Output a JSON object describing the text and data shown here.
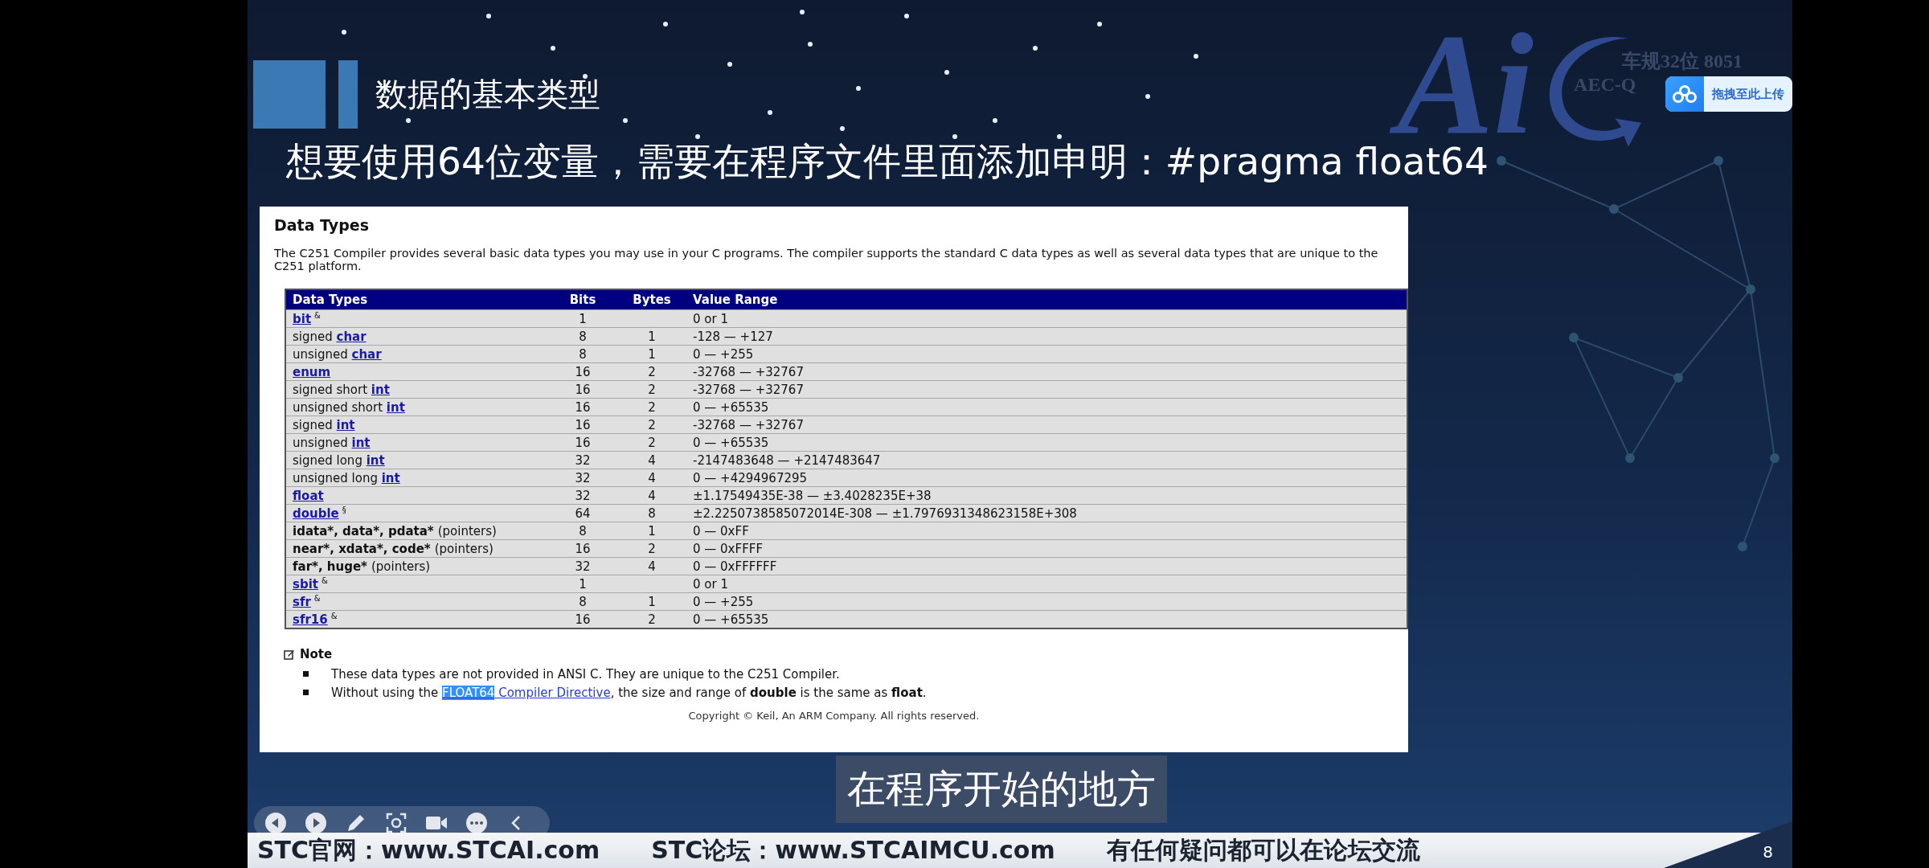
{
  "slide": {
    "title": "数据的基本类型",
    "subheading": "想要使用64位变量，需要在程序文件里面添加申明：#pragma float64",
    "logo": {
      "mark": "Ai",
      "line_1": "车规32位 8051",
      "line_2": "AEC-Q"
    },
    "upload_button": "拖拽至此上传",
    "page_number": "8"
  },
  "document": {
    "title": "Data Types",
    "intro": "The C251 Compiler provides several basic data types you may use in your C programs. The compiler supports the standard C data types as well as several data types that are unique to the C251 platform.",
    "table": {
      "columns": [
        "Data Types",
        "Bits",
        "Bytes",
        "Value Range"
      ],
      "rows": [
        {
          "type": {
            "link": "bit",
            "mark": "&"
          },
          "bits": "1",
          "value_range": "0 or 1"
        },
        {
          "type": {
            "text": "signed ",
            "link": "char"
          },
          "bits": "8",
          "bytes": "1",
          "value_range": "-128 — +127"
        },
        {
          "type": {
            "text": "unsigned ",
            "link": "char"
          },
          "bits": "8",
          "bytes": "1",
          "value_range": "0 — +255"
        },
        {
          "type": {
            "link": "enum"
          },
          "bits": "16",
          "bytes": "2",
          "value_range": "-32768 — +32767"
        },
        {
          "type": {
            "text": "signed short ",
            "link": "int"
          },
          "bits": "16",
          "bytes": "2",
          "value_range": "-32768 — +32767"
        },
        {
          "type": {
            "text": "unsigned short ",
            "link": "int"
          },
          "bits": "16",
          "bytes": "2",
          "value_range": "0 — +65535"
        },
        {
          "type": {
            "text": "signed ",
            "link": "int"
          },
          "bits": "16",
          "bytes": "2",
          "value_range": "-32768 — +32767"
        },
        {
          "type": {
            "text": "unsigned ",
            "link": "int"
          },
          "bits": "16",
          "bytes": "2",
          "value_range": "0 — +65535"
        },
        {
          "type": {
            "text": "signed long ",
            "link": "int"
          },
          "bits": "32",
          "bytes": "4",
          "value_range": "-2147483648 — +2147483647"
        },
        {
          "type": {
            "text": "unsigned long ",
            "link": "int"
          },
          "bits": "32",
          "bytes": "4",
          "value_range": "0 — +4294967295"
        },
        {
          "type": {
            "link": "float"
          },
          "bits": "32",
          "bytes": "4",
          "value_range": "±1.17549435E-38 — ±3.4028235E+38"
        },
        {
          "type": {
            "link": "double",
            "mark": "§"
          },
          "bits": "64",
          "bytes": "8",
          "value_range": "±2.2250738585072014E-308 — ±1.7976931348623158E+308"
        },
        {
          "type": {
            "bold": "idata*, data*, pdata*",
            "note": "(pointers)"
          },
          "bits": "8",
          "bytes": "1",
          "value_range": "0 — 0xFF"
        },
        {
          "type": {
            "bold": "near*, xdata*, code*",
            "note": "(pointers)"
          },
          "bits": "16",
          "bytes": "2",
          "value_range": "0 — 0xFFFF"
        },
        {
          "type": {
            "bold": "far*, huge*",
            "note": "(pointers)"
          },
          "bits": "32",
          "bytes": "4",
          "value_range": "0 — 0xFFFFFF"
        },
        {
          "type": {
            "link": "sbit",
            "mark": "&"
          },
          "bits": "1",
          "value_range": "0 or 1"
        },
        {
          "type": {
            "link": "sfr",
            "mark": "&"
          },
          "bits": "8",
          "bytes": "1",
          "value_range": "0 — +255"
        },
        {
          "type": {
            "link": "sfr16",
            "mark": "&"
          },
          "bits": "16",
          "bytes": "2",
          "value_range": "0 — +65535"
        }
      ]
    },
    "note": {
      "title": "Note",
      "items": [
        {
          "text": "These data types are not provided in ANSI C. They are unique to the C251 Compiler."
        },
        {
          "text": "Without using the ",
          "link_selected": "FLOAT64",
          "link_rest": " Compiler Directive",
          "after": ", the size and range of **double** is the same as **float**."
        }
      ]
    },
    "copyright": "Copyright © Keil, An ARM Company. All rights reserved."
  },
  "subtitle": "在程序开始的地方",
  "footer": [
    "STC官网：www.STCAI.com",
    "STC论坛：www.STCAIMCU.com",
    "有任何疑问都可以在论坛交流"
  ]
}
